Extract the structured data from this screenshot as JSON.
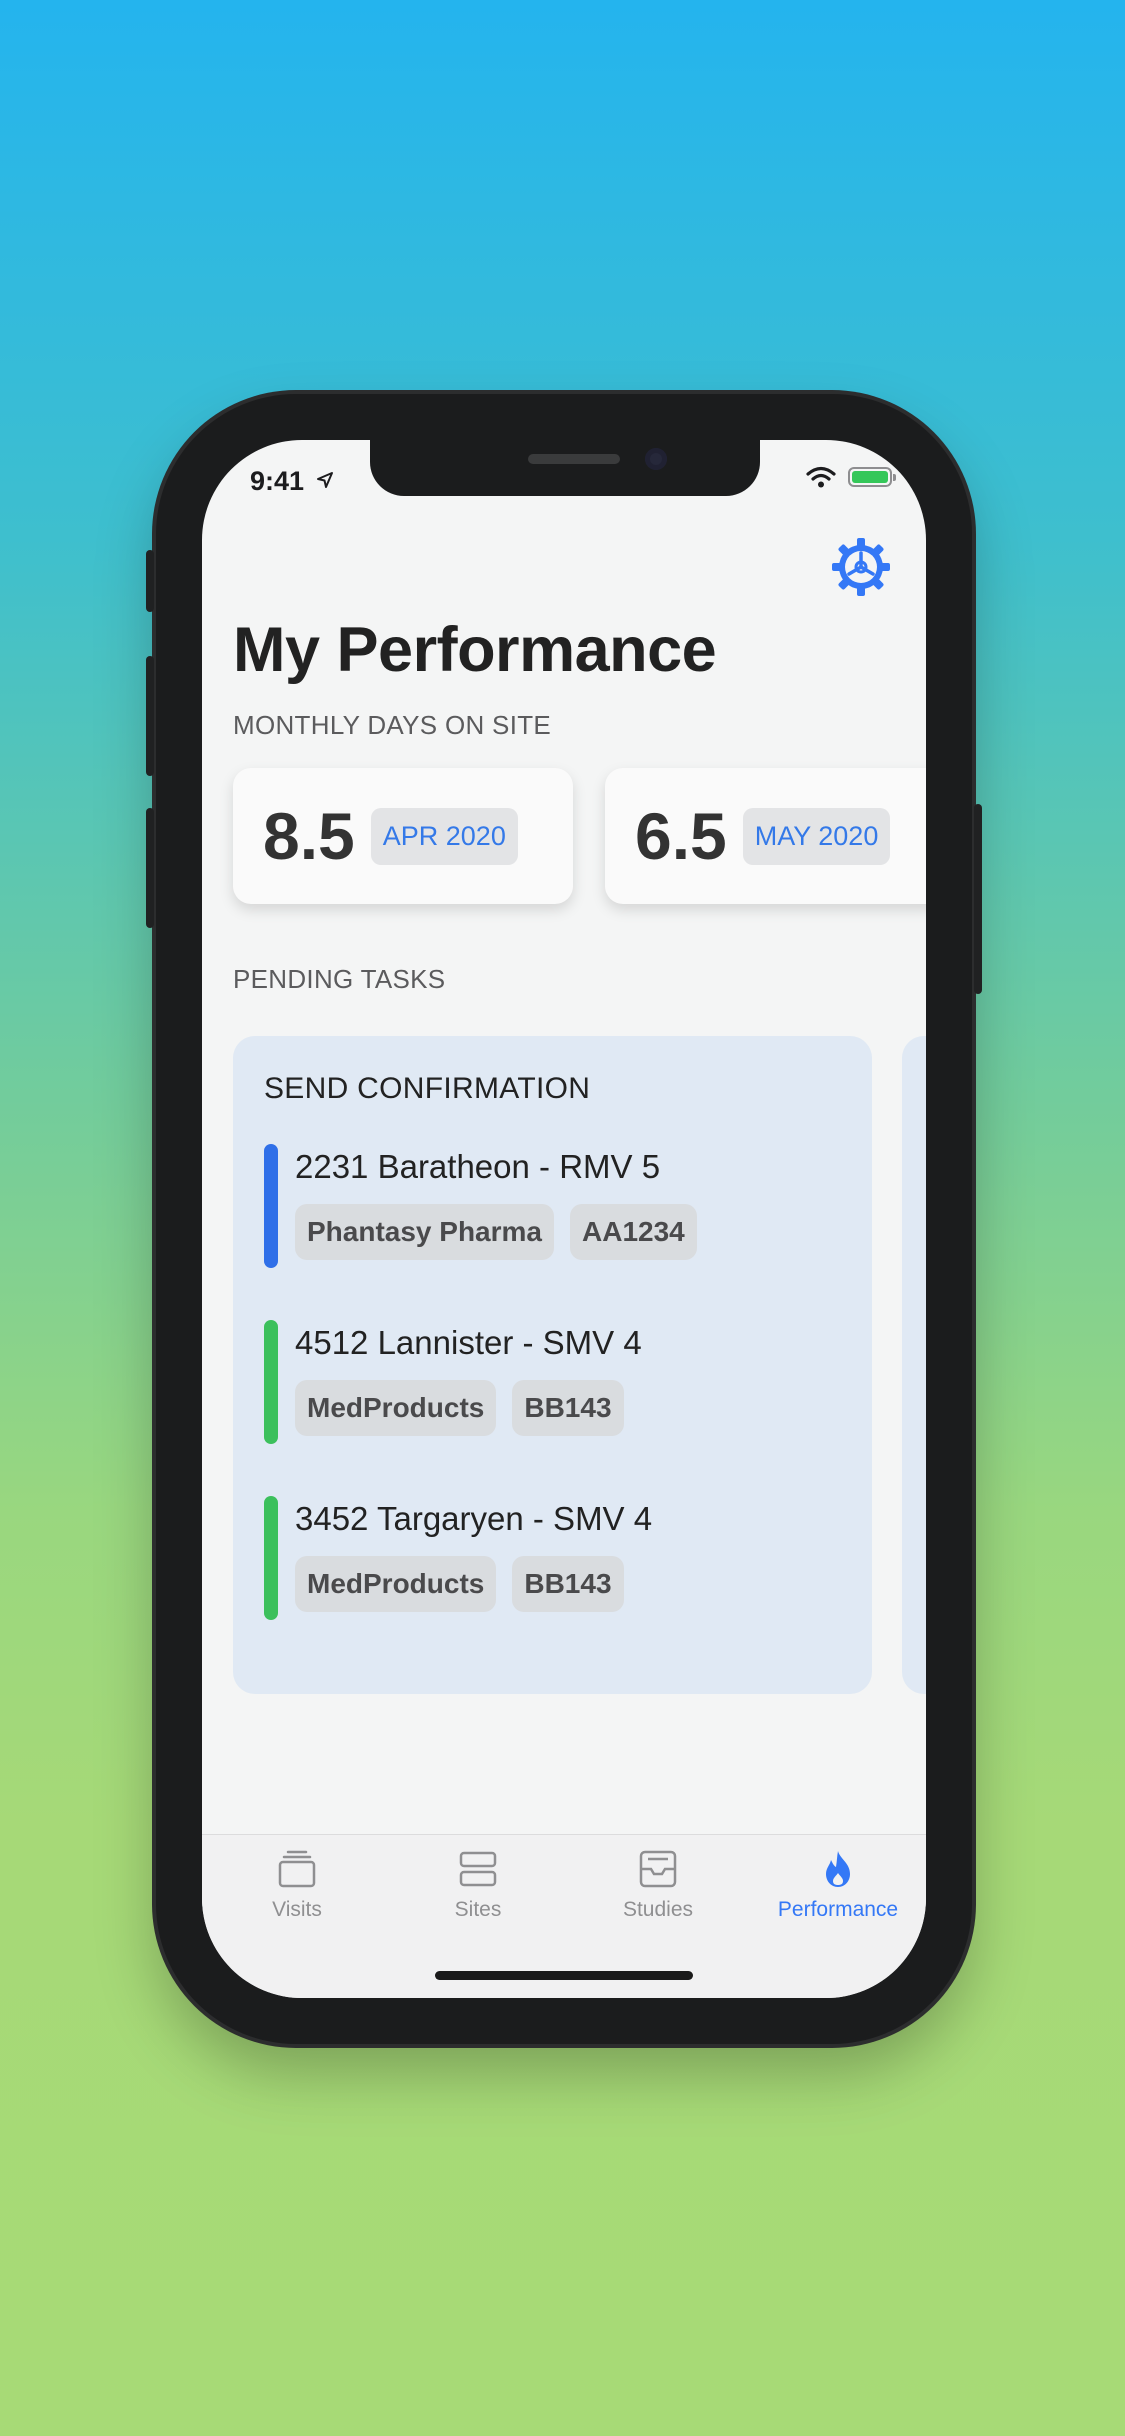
{
  "status_bar": {
    "time": "9:41"
  },
  "header": {
    "title": "My Performance"
  },
  "monthly": {
    "label": "MONTHLY DAYS ON SITE",
    "cards": [
      {
        "value": "8.5",
        "period": "APR 2020"
      },
      {
        "value": "6.5",
        "period": "MAY 2020"
      }
    ]
  },
  "pending": {
    "label": "PENDING TASKS",
    "panel_title": "SEND CONFIRMATION",
    "tasks": [
      {
        "title": "2231 Baratheon - RMV 5",
        "tags": [
          "Phantasy Pharma",
          "AA1234"
        ],
        "color": "#2f6fe8"
      },
      {
        "title": "4512 Lannister - SMV 4",
        "tags": [
          "MedProducts",
          "BB143"
        ],
        "color": "#3cc05c"
      },
      {
        "title": "3452 Targaryen - SMV 4",
        "tags": [
          "MedProducts",
          "BB143"
        ],
        "color": "#3cc05c"
      }
    ]
  },
  "tabbar": {
    "tabs": [
      {
        "label": "Visits",
        "icon": "stack-icon"
      },
      {
        "label": "Sites",
        "icon": "server-icon"
      },
      {
        "label": "Studies",
        "icon": "inbox-icon"
      },
      {
        "label": "Performance",
        "icon": "flame-icon",
        "active": true
      }
    ]
  },
  "colors": {
    "accent": "#3478f6",
    "panel": "#e0e9f4",
    "background": "#f4f5f5"
  }
}
